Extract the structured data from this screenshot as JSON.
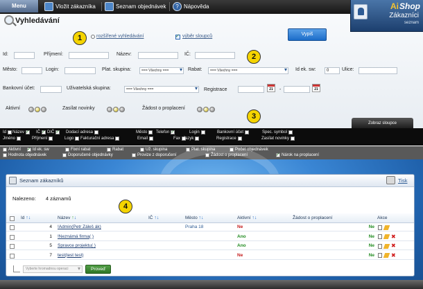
{
  "topbar": {
    "menu": "Menu",
    "items": [
      {
        "label": "Vložit zákazníka",
        "icon": "add-customer-icon"
      },
      {
        "label": "Seznam objednávek",
        "icon": "orders-list-icon"
      },
      {
        "label": "Nápověda",
        "icon": "help-icon"
      }
    ]
  },
  "brand": {
    "prefix": "Ai",
    "name": "Shop",
    "section": "Zákazníci",
    "subsection": "seznam"
  },
  "search": {
    "title": "Vyhledávání",
    "advanced_link": "rozšířené vyhledávání",
    "columns_toggle": "výběr sloupců",
    "submit": "Vypiš",
    "fields": {
      "id": "Id:",
      "surname": "Příjmení:",
      "name": "Název:",
      "ic": "IČ:",
      "city": "Město:",
      "login": "Login:",
      "pay_group": "Plat. skupina:",
      "pay_group_value": "=== Všechny ===",
      "discount": "Rabat:",
      "discount_value": "=== Všechny ===",
      "ek_sw": "Id ek. sw:",
      "ek_sw_value": "0",
      "street": "Ulice:",
      "bank": "Bankovní účet:",
      "user_group": "Uživatelská skupina:",
      "user_group_value": "=== Všechny ===",
      "registration": "Registrace",
      "reg_sep": "-",
      "active": "Aktivní",
      "newsletter": "Zasílat novinky",
      "request": "Žádost o proplacení"
    },
    "calendar_day": "21"
  },
  "callouts": [
    "1",
    "2",
    "3",
    "4"
  ],
  "columns_button": "Zobraz sloupce",
  "column_choices": {
    "row1": [
      {
        "label": "Id",
        "checked": false
      },
      {
        "label": "Název",
        "checked": true
      },
      {
        "label": "IČ",
        "checked": true
      },
      {
        "label": "DIČ",
        "checked": true
      },
      {
        "label": "Dodací adresa",
        "checked": false
      },
      {
        "label": "Město",
        "checked": false
      },
      {
        "label": "Telefon",
        "checked": true
      },
      {
        "label": "Login",
        "checked": false
      },
      {
        "label": "Bankovní účet",
        "checked": false
      },
      {
        "label": "Spec. symbol",
        "checked": false
      }
    ],
    "row2": [
      {
        "label": "Jméno",
        "checked": false
      },
      {
        "label": "Příjmení",
        "checked": false
      },
      {
        "label": "Logo",
        "checked": false
      },
      {
        "label": "Fakturační adresa",
        "checked": false
      },
      {
        "label": "Email",
        "checked": false
      },
      {
        "label": "Fax",
        "checked": false
      },
      {
        "label": "Jazyk",
        "checked": false
      },
      {
        "label": "Registrace",
        "checked": false
      },
      {
        "label": "Zasílat novinky",
        "checked": false
      }
    ],
    "row3": [
      {
        "label": "Aktivní",
        "checked": false
      },
      {
        "label": "Id ek. sw",
        "checked": true
      },
      {
        "label": "Fixní rabat",
        "checked": false
      },
      {
        "label": "Rabat",
        "checked": false
      },
      {
        "label": "Už. skupina",
        "checked": false
      },
      {
        "label": "Plat. skupina",
        "checked": false
      },
      {
        "label": "Počet objednávek",
        "checked": false
      }
    ],
    "row4": [
      {
        "label": "Hodnota objednávek",
        "checked": false
      },
      {
        "label": "Doporučené objednávky",
        "checked": false
      },
      {
        "label": "Provize z doporučení",
        "checked": false
      },
      {
        "label": "Žádost o proplacení",
        "checked": false
      },
      {
        "label": "Nárok na proplacení",
        "checked": true
      }
    ]
  },
  "list": {
    "title": "Seznam zákazníků",
    "print": "Tisk",
    "found_label": "Nalezeno:",
    "found_value": "4 záznamů",
    "headers": [
      "Id",
      "Název",
      "IČ",
      "Město",
      "Aktivní",
      "Žádost o proplacení",
      "Akce"
    ],
    "rows": [
      {
        "id": "4",
        "name": "!Admin(Petr Záleš ák)",
        "ic": "",
        "city": "Praha 18",
        "active": "Ne",
        "request": "Ne"
      },
      {
        "id": "1",
        "name": "!Neznámá firma( )",
        "ic": "",
        "city": "",
        "active": "Ano",
        "request": "Ne"
      },
      {
        "id": "5",
        "name": "Spravce projektu( )",
        "ic": "",
        "city": "",
        "active": "Ano",
        "request": "Ne"
      },
      {
        "id": "7",
        "name": "test(test test)",
        "ic": "",
        "city": "",
        "active": "Ne",
        "request": "Ne"
      }
    ],
    "bulk_select": "Vyberte hromadnou operaci",
    "bulk_submit": "Proveď"
  }
}
